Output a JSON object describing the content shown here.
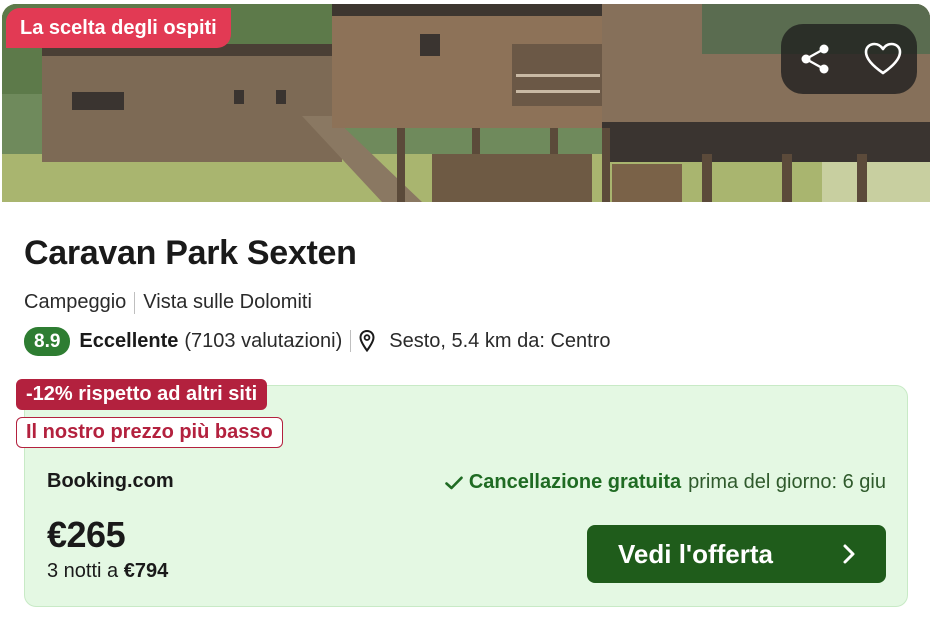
{
  "hero": {
    "badge": "La scelta degli ospiti",
    "actions": {
      "share_icon": "share-icon",
      "favorite_icon": "heart-icon"
    }
  },
  "listing": {
    "name": "Caravan Park Sexten",
    "type": "Campeggio",
    "feature": "Vista sulle Dolomiti",
    "score": "8.9",
    "rating_word": "Eccellente",
    "reviews": "(7103 valutazioni)",
    "location_icon": "map-pin-icon",
    "location": "Sesto, 5.4 km da: Centro"
  },
  "deal": {
    "discount_tag": "-12% rispetto ad altri siti",
    "lowest_tag": "Il nostro prezzo più basso",
    "provider": "Booking.com",
    "cancellation_icon": "check-icon",
    "cancellation_strong": "Cancellazione gratuita",
    "cancellation_detail": "prima del giorno: 6 giu",
    "price": "€265",
    "nights_prefix": "3 notti a",
    "total": "€794",
    "cta_label": "Vedi l'offerta",
    "cta_icon": "chevron-right-icon"
  },
  "colors": {
    "badge": "#e23a54",
    "score": "#2e7d32",
    "discount": "#b3213e",
    "deal_bg": "#e4f8e3",
    "cta": "#1f5c1b"
  }
}
